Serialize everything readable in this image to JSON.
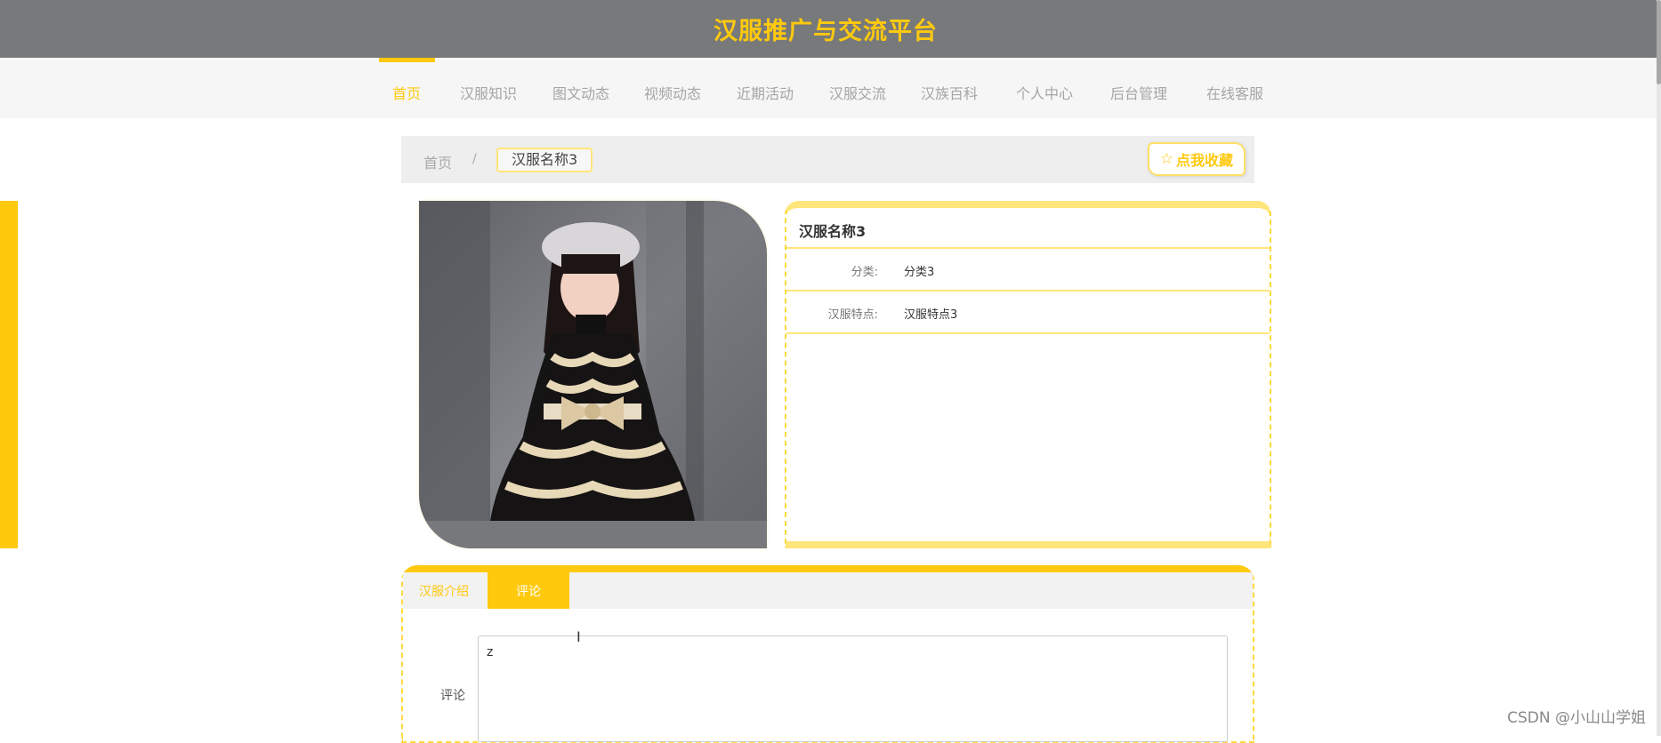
{
  "header": {
    "title": "汉服推广与交流平台"
  },
  "nav": {
    "items": [
      {
        "label": "首页",
        "active": true
      },
      {
        "label": "汉服知识"
      },
      {
        "label": "图文动态"
      },
      {
        "label": "视频动态"
      },
      {
        "label": "近期活动"
      },
      {
        "label": "汉服交流"
      },
      {
        "label": "汉族百科"
      },
      {
        "label": "个人中心"
      },
      {
        "label": "后台管理"
      },
      {
        "label": "在线客服"
      }
    ]
  },
  "breadcrumb": {
    "home": "首页",
    "separator": "/",
    "current": "汉服名称3"
  },
  "favorite": {
    "icon": "star-outline-icon",
    "label": "点我收藏"
  },
  "detail": {
    "name": "汉服名称3",
    "rows": [
      {
        "label": "分类:",
        "value": "分类3"
      },
      {
        "label": "汉服特点:",
        "value": "汉服特点3"
      }
    ]
  },
  "tabs": {
    "intro": "汉服介绍",
    "comment": "评论"
  },
  "comment": {
    "label": "评论",
    "value": "z"
  },
  "watermark": "CSDN @小山山学姐",
  "colors": {
    "accent": "#ffc90e",
    "header": "#77797a",
    "nav_bg": "#f6f6f6"
  }
}
